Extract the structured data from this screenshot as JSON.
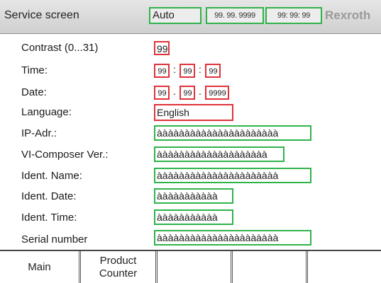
{
  "header": {
    "title": "Service screen",
    "mode": "Auto",
    "date_time": [
      "99. 99. 9999",
      "99: 99: 99"
    ],
    "brand": "Rexroth"
  },
  "fields": [
    {
      "label": "Contrast (0...31)",
      "value": "99"
    },
    {
      "label": "Time:",
      "parts": [
        "99",
        ":",
        "99",
        ":",
        "99"
      ]
    },
    {
      "label": "Date:",
      "parts": [
        "99",
        ".",
        "99",
        ".",
        "9999"
      ]
    },
    {
      "label": "Language:",
      "value": "English"
    },
    {
      "label": "IP-Adr.:",
      "value": "àààààààààààààààààààààà"
    },
    {
      "label": "VI-Composer Ver.:",
      "value": "àààààààààààààààààààà"
    },
    {
      "label": "Ident. Name:",
      "value": "àààààààààààààààààààààà"
    },
    {
      "label": "Ident. Date:",
      "value": "ààààààààààà"
    },
    {
      "label": "Ident. Time:",
      "value": "ààààààààààà"
    },
    {
      "label": "Serial number",
      "value": "àààààààààààààààààààààà"
    }
  ],
  "footer": {
    "main": "Main",
    "product_counter": [
      "Product",
      "Counter"
    ]
  },
  "colors": {
    "editable_border": "#e0323a",
    "readonly_border": "#2fb34a",
    "brand_text": "#9a9a9a"
  }
}
